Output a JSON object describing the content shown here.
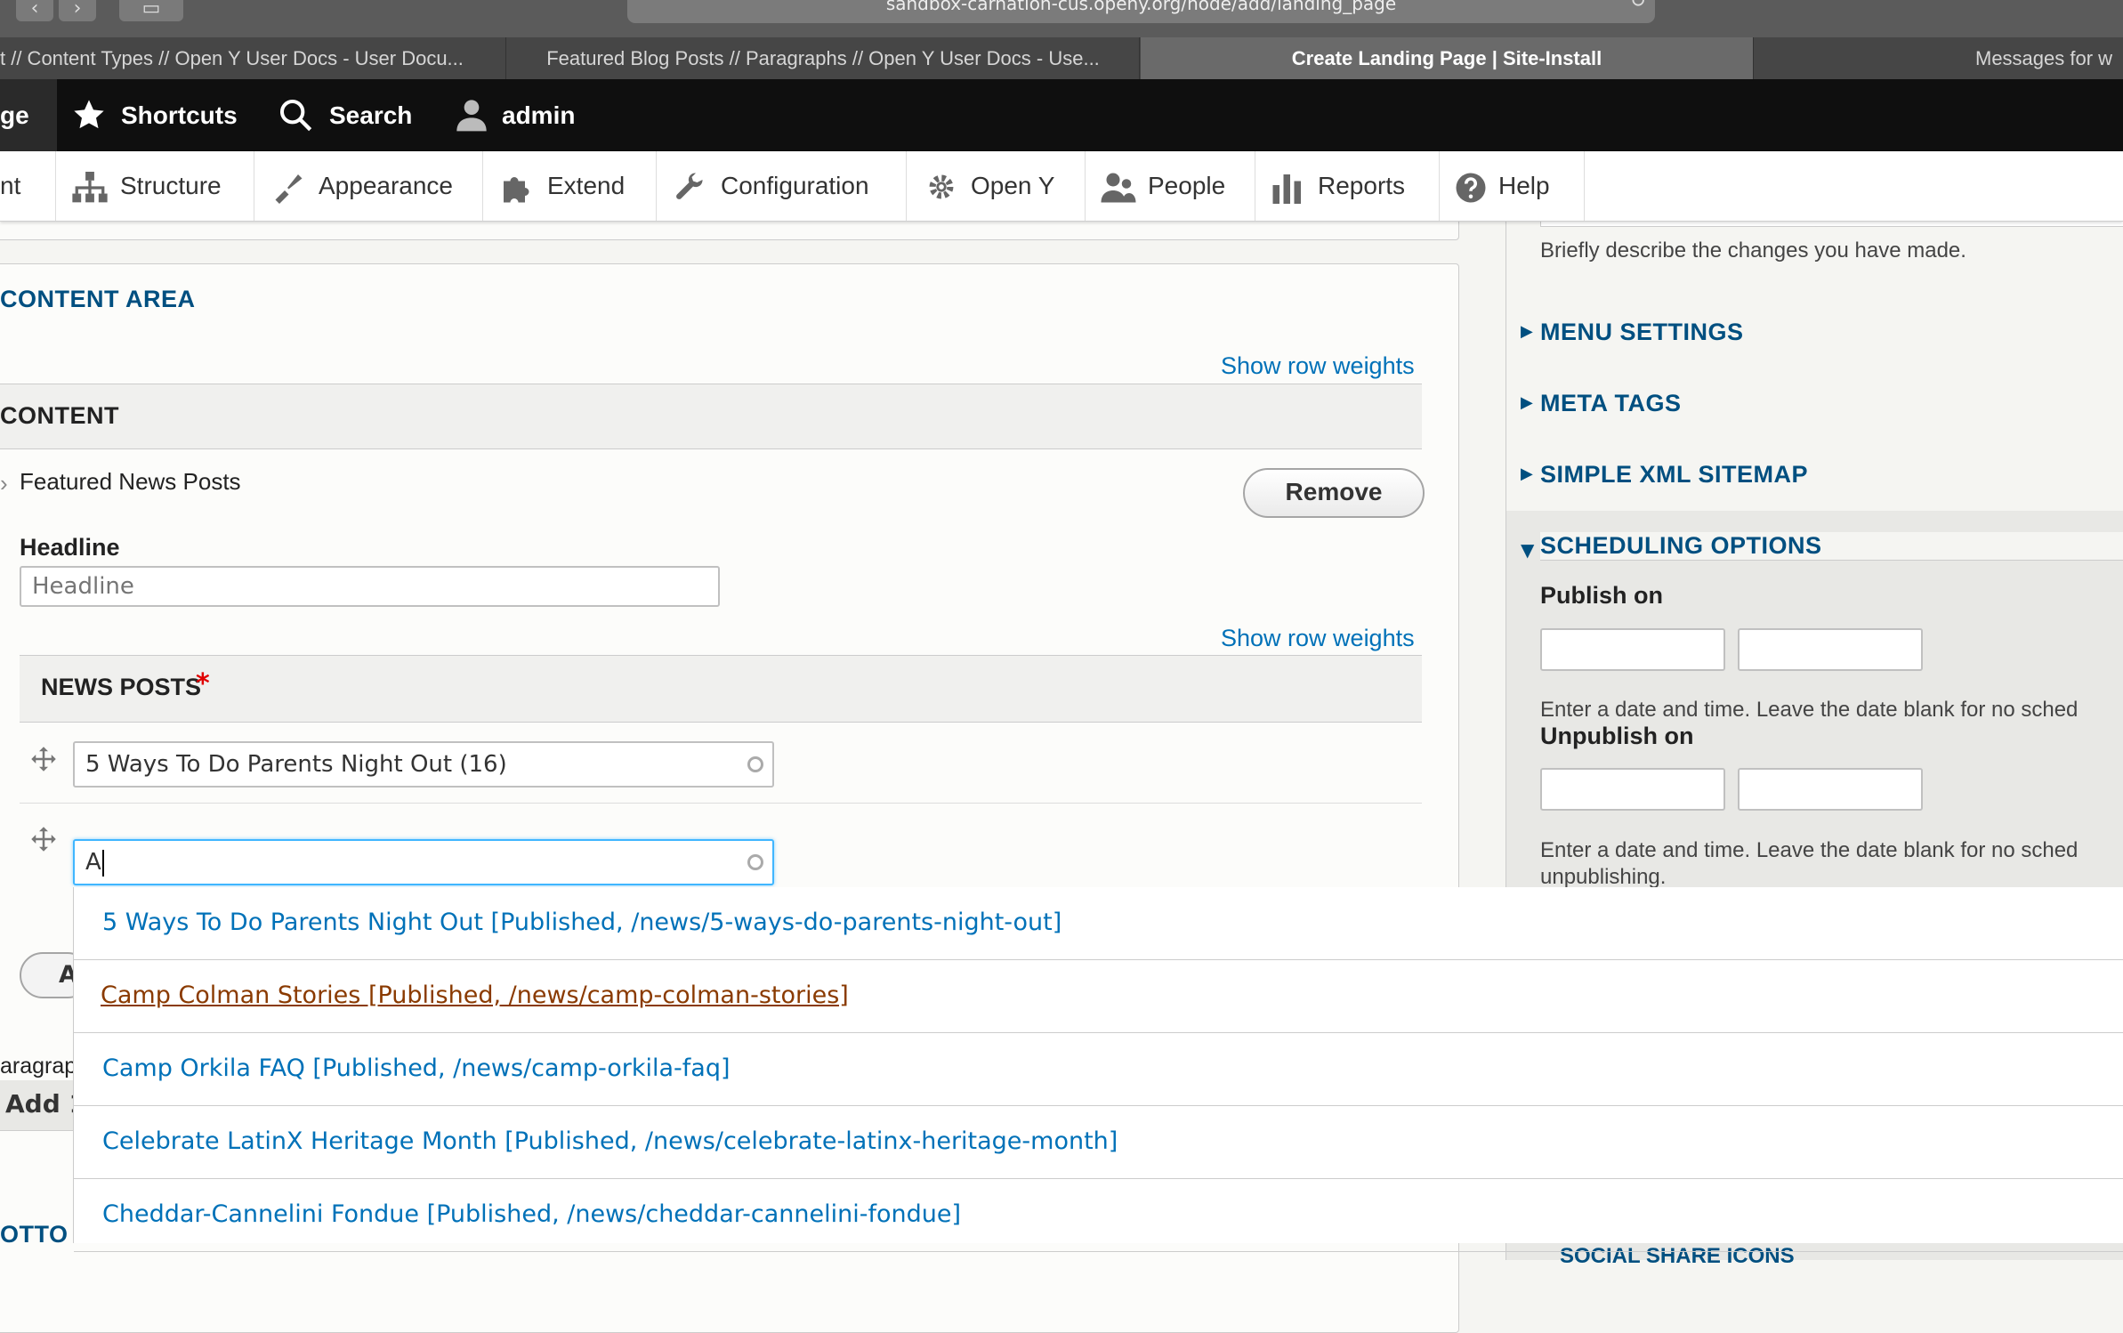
{
  "browser": {
    "url": "sandbox-carnation-cus.openy.org/node/add/landing_page",
    "tabs": [
      {
        "label": "t // Content Types // Open Y User Docs - User Docu..."
      },
      {
        "label": "Featured Blog Posts // Paragraphs // Open Y User Docs - Use..."
      },
      {
        "label": "Create Landing Page | Site-Install"
      },
      {
        "label": "Messages for w"
      }
    ]
  },
  "toolbar": {
    "manage_partial": "ge",
    "shortcuts": "Shortcuts",
    "search": "Search",
    "user": "admin"
  },
  "tray": {
    "items": [
      {
        "label": "nt"
      },
      {
        "label": "Structure"
      },
      {
        "label": "Appearance"
      },
      {
        "label": "Extend"
      },
      {
        "label": "Configuration"
      },
      {
        "label": "Open Y"
      },
      {
        "label": "People"
      },
      {
        "label": "Reports"
      },
      {
        "label": "Help"
      }
    ]
  },
  "main": {
    "content_area_title": "CONTENT AREA",
    "show_row_weights": "Show row weights",
    "content_header": "CONTENT",
    "paragraph_type": "Featured News Posts",
    "remove_label": "Remove",
    "headline_label": "Headline",
    "headline_placeholder": "Headline",
    "news_posts_label": "NEWS POSTS",
    "required_mark": "*",
    "news_item_1": "5 Ways To Do Parents Night Out (16)",
    "news_item_2": "A",
    "add_button_partial": "A",
    "paragraph_partial": "aragrap",
    "add_more_partial": "Add 1",
    "bottom_partial": "OTTO"
  },
  "sidebar": {
    "revision_hint": "Briefly describe the changes you have made.",
    "menu_settings": "MENU SETTINGS",
    "meta_tags": "META TAGS",
    "sitemap": "SIMPLE XML SITEMAP",
    "scheduling": "SCHEDULING OPTIONS",
    "publish_on": "Publish on",
    "publish_hint": "Enter a date and time. Leave the date blank for no sched",
    "unpublish_on": "Unpublish on",
    "unpublish_hint": "Enter a date and time. Leave the date blank for no sched",
    "unpublish_hint_2": "unpublishing.",
    "social_partial": "SOCIAL SHARE ICONS"
  },
  "autocomplete": {
    "items": [
      {
        "label": "5 Ways To Do Parents Night Out [Published, /news/5-ways-do-parents-night-out]"
      },
      {
        "label": "Camp Colman Stories [Published, /news/camp-colman-stories]"
      },
      {
        "label": "Camp Orkila FAQ [Published, /news/camp-orkila-faq]"
      },
      {
        "label": "Celebrate LatinX Heritage Month [Published, /news/celebrate-latinx-heritage-month]"
      },
      {
        "label": "Cheddar-Cannelini Fondue [Published, /news/cheddar-cannelini-fondue]"
      }
    ]
  },
  "colors": {
    "link": "#0071b8",
    "section_title": "#004f80",
    "hover_link": "#8a3a00",
    "focus_ring": "#40b6ff",
    "toolbar_bg": "#0f0f0f",
    "required": "#e00000"
  }
}
